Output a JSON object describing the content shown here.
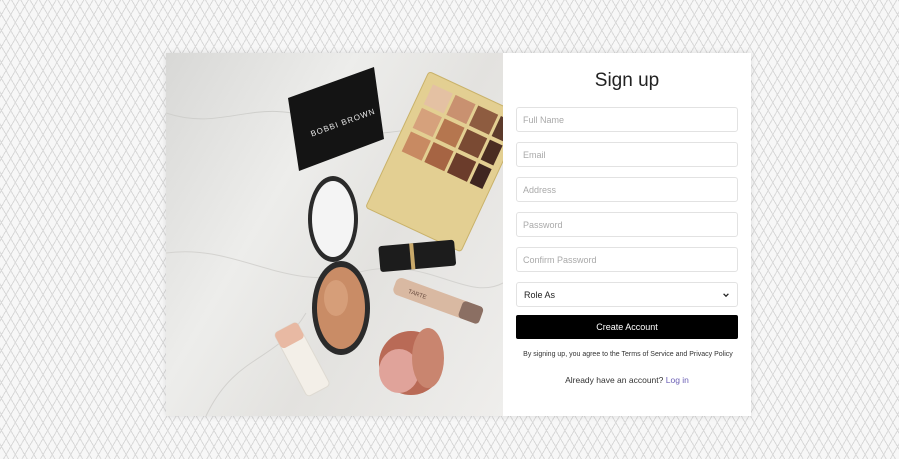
{
  "form": {
    "title": "Sign up",
    "full_name_placeholder": "Full Name",
    "email_placeholder": "Email",
    "address_placeholder": "Address",
    "password_placeholder": "Password",
    "confirm_password_placeholder": "Confirm Password",
    "role_select_value": "Role As",
    "create_account_label": "Create Account",
    "terms_prefix": "By signing up, you agree to the",
    "terms_link": "Terms of Service",
    "terms_and": "and",
    "privacy_link": "Privacy Policy",
    "login_prompt": "Already have an account?",
    "login_link": "Log in"
  },
  "photo": {
    "palette_brand": "BOBBI BROWN",
    "mascara_brand": "TARTE"
  },
  "colors": {
    "button_bg": "#000000",
    "link": "#6b5fb5",
    "card_bg": "#ffffff"
  },
  "icons": {
    "select_arrow": "chevron-down-icon"
  }
}
